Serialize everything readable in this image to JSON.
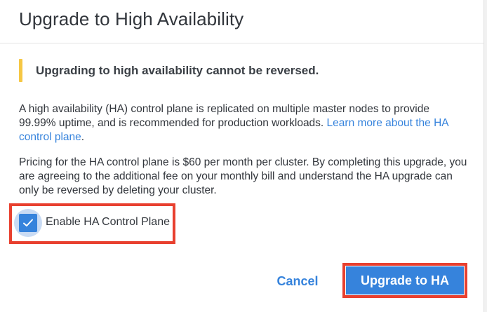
{
  "dialog": {
    "title": "Upgrade to High Availability",
    "notice": "Upgrading to high availability cannot be reversed.",
    "description": {
      "text": "A high availability (HA) control plane is replicated on multiple master nodes to provide 99.99% uptime, and is recommended for production workloads. ",
      "link_label": "Learn more about the HA control plane",
      "trailing": "."
    },
    "pricing": "Pricing for the HA control plane is $60 per month per cluster. By completing this upgrade, you are agreeing to the additional fee on your monthly bill and understand the HA upgrade can only be reversed by deleting your cluster.",
    "checkbox": {
      "label": "Enable HA Control Plane",
      "checked": true,
      "icon": "checkmark-icon"
    },
    "actions": {
      "cancel_label": "Cancel",
      "confirm_label": "Upgrade to HA"
    }
  },
  "colors": {
    "accent": "#3683dc",
    "warning": "#f6c744",
    "annotation": "#e8402f",
    "text": "#32363c"
  }
}
